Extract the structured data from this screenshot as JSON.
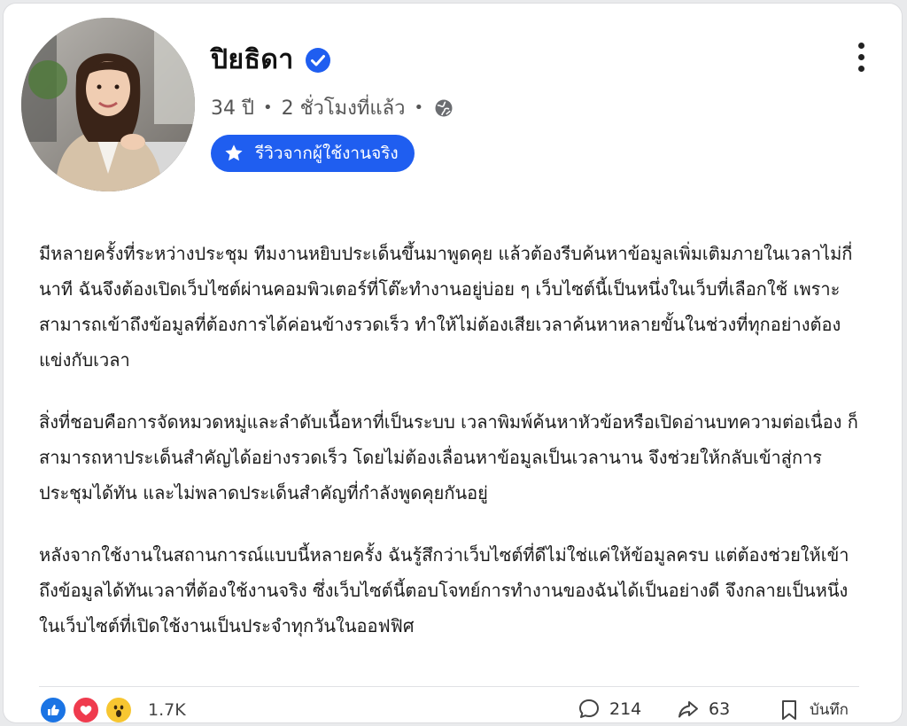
{
  "post": {
    "author": {
      "name": "ปิยธิดา",
      "age": "34 ปี",
      "time": "2 ชั่วโมงที่แล้ว",
      "audience_icon": "globe-icon",
      "verified_icon": "verified-check-icon"
    },
    "badge": {
      "label": "รีวิวจากผู้ใช้งานจริง",
      "icon": "star-icon"
    },
    "paragraphs": [
      "มีหลายครั้งที่ระหว่างประชุม ทีมงานหยิบประเด็นขึ้นมาพูดคุย แล้วต้องรีบค้นหาข้อมูลเพิ่มเติมภายในเวลาไม่กี่นาที ฉันจึงต้องเปิดเว็บไซต์ผ่านคอมพิวเตอร์ที่โต๊ะทำงานอยู่บ่อย ๆ เว็บไซต์นี้เป็นหนึ่งในเว็บที่เลือกใช้ เพราะสามารถเข้าถึงข้อมูลที่ต้องการได้ค่อนข้างรวดเร็ว ทำให้ไม่ต้องเสียเวลาค้นหาหลายขั้นในช่วงที่ทุกอย่างต้องแข่งกับเวลา",
      "สิ่งที่ชอบคือการจัดหมวดหมู่และลำดับเนื้อหาที่เป็นระบบ เวลาพิมพ์ค้นหาหัวข้อหรือเปิดอ่านบทความต่อเนื่อง ก็สามารถหาประเด็นสำคัญได้อย่างรวดเร็ว โดยไม่ต้องเลื่อนหาข้อมูลเป็นเวลานาน จึงช่วยให้กลับเข้าสู่การประชุมได้ทัน และไม่พลาดประเด็นสำคัญที่กำลังพูดคุยกันอยู่",
      "หลังจากใช้งานในสถานการณ์แบบนี้หลายครั้ง ฉันรู้สึกว่าเว็บไซต์ที่ดีไม่ใช่แค่ให้ข้อมูลครบ แต่ต้องช่วยให้เข้าถึงข้อมูลได้ทันเวลาที่ต้องใช้งานจริง ซึ่งเว็บไซต์นี้ตอบโจทย์การทำงานของฉันได้เป็นอย่างดี จึงกลายเป็นหนึ่งในเว็บไซต์ที่เปิดใช้งานเป็นประจำทุกวันในออฟฟิศ"
    ],
    "footer": {
      "reactions": [
        "like-icon",
        "heart-icon",
        "wow-icon"
      ],
      "reaction_count": "1.7K",
      "comments": "214",
      "shares": "63",
      "save_label": "บันทึก"
    }
  },
  "colors": {
    "accent": "#1f5ef0",
    "like": "#1b74e4",
    "love": "#ef3b4e",
    "wow": "#f7c631"
  }
}
